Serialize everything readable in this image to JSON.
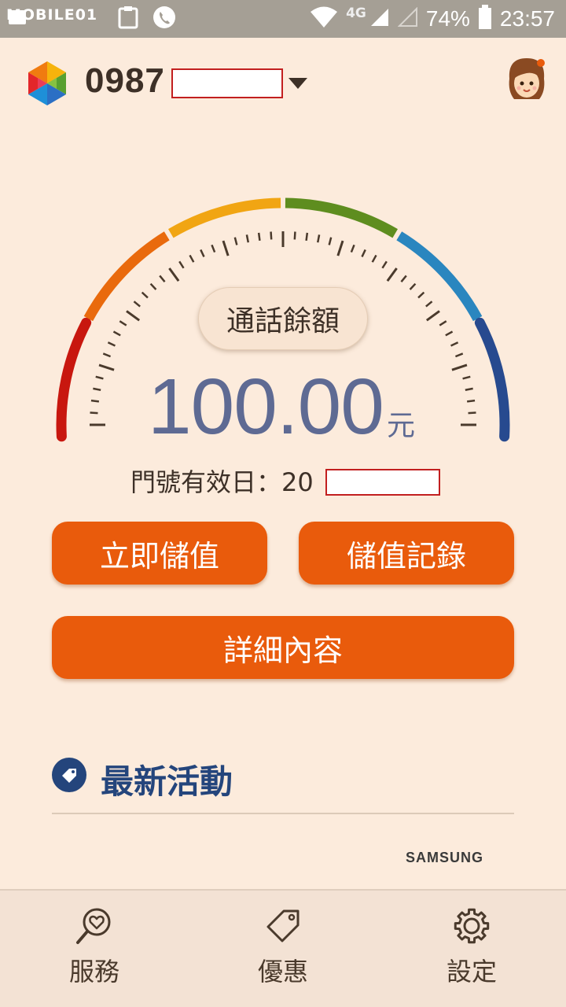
{
  "status_bar": {
    "watermark": "MOBILE01",
    "network": "4G",
    "battery": "74%",
    "time": "23:57"
  },
  "header": {
    "phone_number": "0987"
  },
  "balance": {
    "label": "通話餘額",
    "amount": "100.00",
    "unit": "元"
  },
  "expiry": {
    "label": "門號有效日：20"
  },
  "buttons": {
    "topup": "立即儲值",
    "history": "儲值記錄",
    "details": "詳細內容"
  },
  "section": {
    "title": "最新活動",
    "brand": "SAMSUNG"
  },
  "bottom_nav": {
    "items": [
      {
        "label": "服務",
        "icon": "heart-search-icon"
      },
      {
        "label": "優惠",
        "icon": "tag-icon"
      },
      {
        "label": "設定",
        "icon": "gear-icon"
      }
    ]
  },
  "colors": {
    "accent_button": "#e95b0c",
    "amount_text": "#5e6a93",
    "section_title": "#24457c",
    "background": "#fcebdc"
  }
}
